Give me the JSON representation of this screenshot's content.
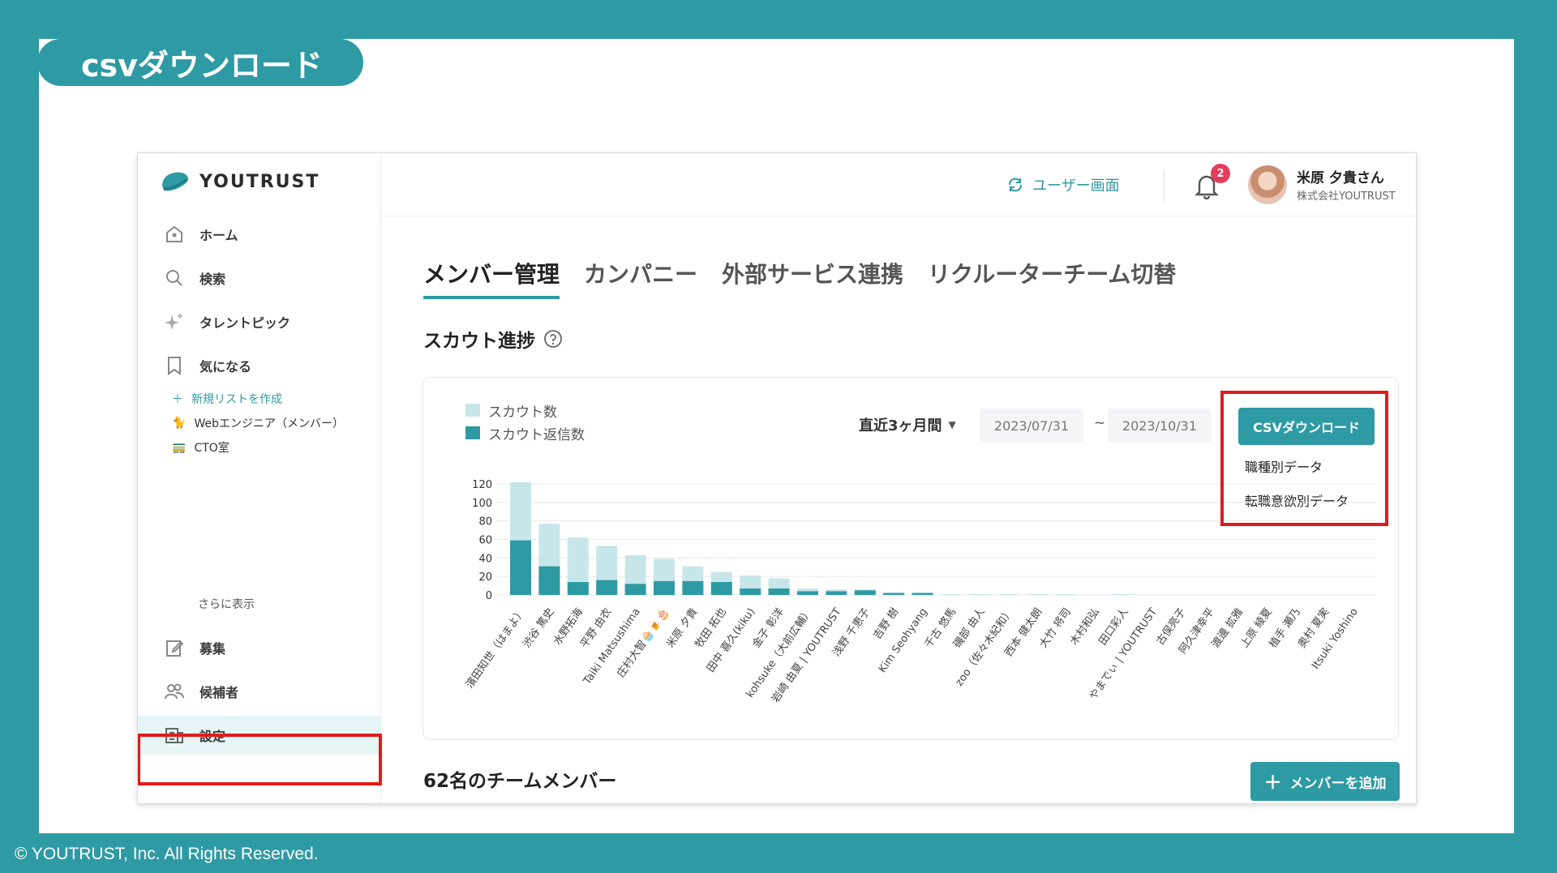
{
  "slide": {
    "title": "csvダウンロード",
    "copyright": "© YOUTRUST, Inc. All Rights Reserved."
  },
  "colors": {
    "teal": "#2e9aa4",
    "light_teal": "#c7e6ea",
    "highlight_red": "#e21b1b",
    "badge": "#e43d5a"
  },
  "sidebar": {
    "logo_text": "YOUTRUST",
    "items": [
      {
        "label": "ホーム",
        "icon": "home-icon"
      },
      {
        "label": "検索",
        "icon": "search-icon"
      },
      {
        "label": "タレントピック",
        "icon": "sparkle-icon"
      },
      {
        "label": "気になる",
        "icon": "bookmark-icon"
      }
    ],
    "new_list": "新規リストを作成",
    "lists": [
      {
        "label": "Webエンジニア（メンバー）",
        "icon": "cat-emoji-icon"
      },
      {
        "label": "CTO室",
        "icon": "tram-emoji-icon"
      }
    ],
    "show_more": "さらに表示",
    "bottom_items": [
      {
        "label": "募集",
        "icon": "edit-icon"
      },
      {
        "label": "候補者",
        "icon": "people-icon"
      },
      {
        "label": "設定",
        "icon": "building-icon"
      }
    ]
  },
  "header": {
    "user_view": "ユーザー画面",
    "notification_count": "2",
    "user_name": "米原 夕貴さん",
    "user_company": "株式会社YOUTRUST"
  },
  "tabs": [
    "メンバー管理",
    "カンパニー",
    "外部サービス連携",
    "リクルーターチーム切替"
  ],
  "section_title": "スカウト進捗",
  "filters": {
    "period": "直近3ヶ月間",
    "date_from": "2023/07/31",
    "tilde": "~",
    "date_to": "2023/10/31"
  },
  "csv": {
    "button": "CSVダウンロード",
    "menu": [
      "職種別データ",
      "転職意欲別データ"
    ]
  },
  "chart_data": {
    "type": "bar",
    "series": [
      {
        "name": "スカウト数",
        "values": [
          122,
          77,
          62,
          53,
          43,
          39,
          31,
          25,
          21,
          18,
          7,
          6,
          6,
          3,
          3,
          1,
          1,
          1,
          1,
          1,
          0,
          1,
          0,
          0,
          0,
          0,
          0,
          0,
          0
        ]
      },
      {
        "name": "スカウト返信数",
        "values": [
          59,
          31,
          14,
          16,
          12,
          15,
          15,
          14,
          7,
          7,
          4,
          4,
          5,
          2,
          2,
          0,
          0,
          0,
          0,
          0,
          0,
          0,
          0,
          0,
          0,
          0,
          0,
          0,
          0
        ]
      }
    ],
    "categories": [
      "濱田知世（はまよ）",
      "渋谷 篤史",
      "水野拓海",
      "平野 由衣",
      "Taiki Matsushima",
      "庄村大智🧁🍺🎂",
      "米原 夕貴",
      "牧田 拓也",
      "田中 喜久(kiku)",
      "金子 彰洋",
      "kohsuke（大前広輔）",
      "岩崎 由夏 | YOUTRUST",
      "浅野 千恵子",
      "吉野 樹",
      "Kim Seohyang",
      "千古 悠馬",
      "磯部 由人",
      "zoo（佐々木紀和）",
      "西本 健太朗",
      "大竹 将司",
      "木村和弘",
      "田口彩人",
      "やまでぃ | YOUTRUST",
      "古俣亮子",
      "阿久津幸平",
      "渡邊 拡雅",
      "上原 綾夏",
      "植手 瀬乃",
      "奥村 夏実",
      "Itsuki Yoshino"
    ],
    "ylim": [
      0,
      120
    ],
    "yticks": [
      0,
      20,
      40,
      60,
      80,
      100,
      120
    ],
    "grid": true,
    "legend_position": "top-left"
  },
  "members": {
    "title": "62名のチームメンバー",
    "add_button": "メンバーを追加"
  }
}
